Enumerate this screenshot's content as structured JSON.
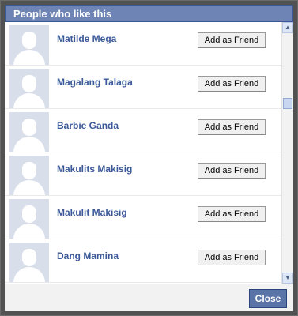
{
  "dialog": {
    "title": "People who like this",
    "close_label": "Close"
  },
  "people": [
    {
      "name": "Matilde Mega",
      "action": "Add as Friend"
    },
    {
      "name": "Magalang Talaga",
      "action": "Add as Friend"
    },
    {
      "name": "Barbie Ganda",
      "action": "Add as Friend"
    },
    {
      "name": "Makulits Makisig",
      "action": "Add as Friend"
    },
    {
      "name": "Makulit Makisig",
      "action": "Add as Friend"
    },
    {
      "name": "Dang Mamina",
      "action": "Add as Friend"
    }
  ],
  "colors": {
    "header_bg": "#6d84b4",
    "name_link": "#3b5998",
    "close_button": "#5b74a8"
  },
  "icons": {
    "avatar": "default-profile-silhouette",
    "scroll_up": "chevron-up-icon",
    "scroll_down": "chevron-down-icon"
  }
}
